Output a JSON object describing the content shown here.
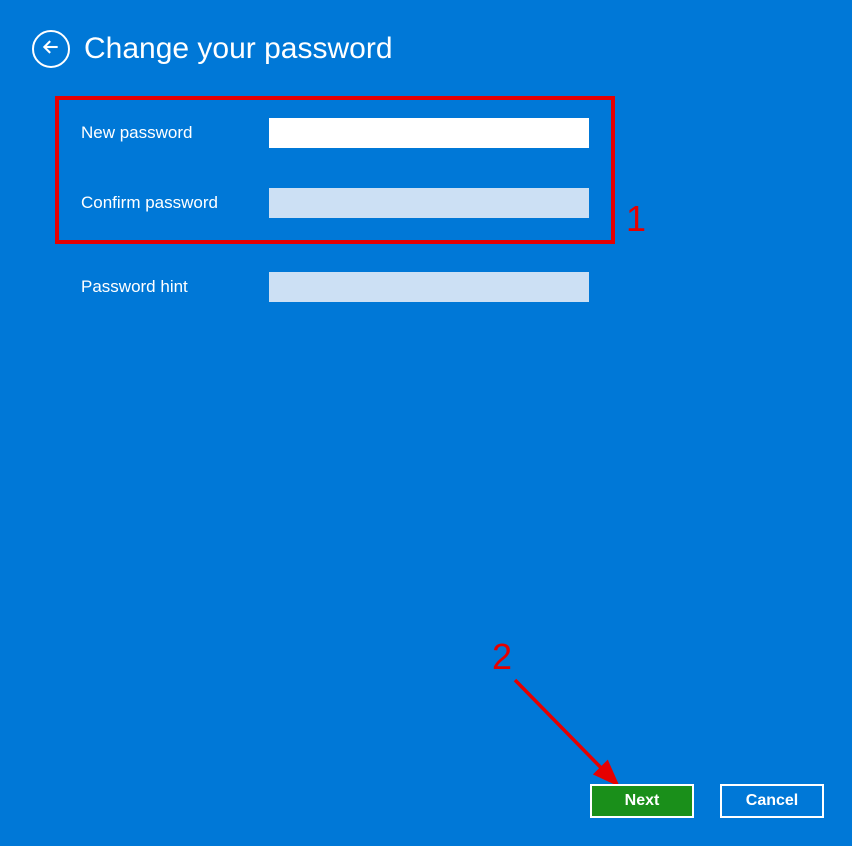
{
  "header": {
    "title": "Change your password"
  },
  "form": {
    "new_password": {
      "label": "New password",
      "value": ""
    },
    "confirm_password": {
      "label": "Confirm password",
      "value": ""
    },
    "password_hint": {
      "label": "Password hint",
      "value": ""
    }
  },
  "buttons": {
    "next": "Next",
    "cancel": "Cancel"
  },
  "annotations": {
    "box1_number": "1",
    "arrow2_number": "2"
  }
}
